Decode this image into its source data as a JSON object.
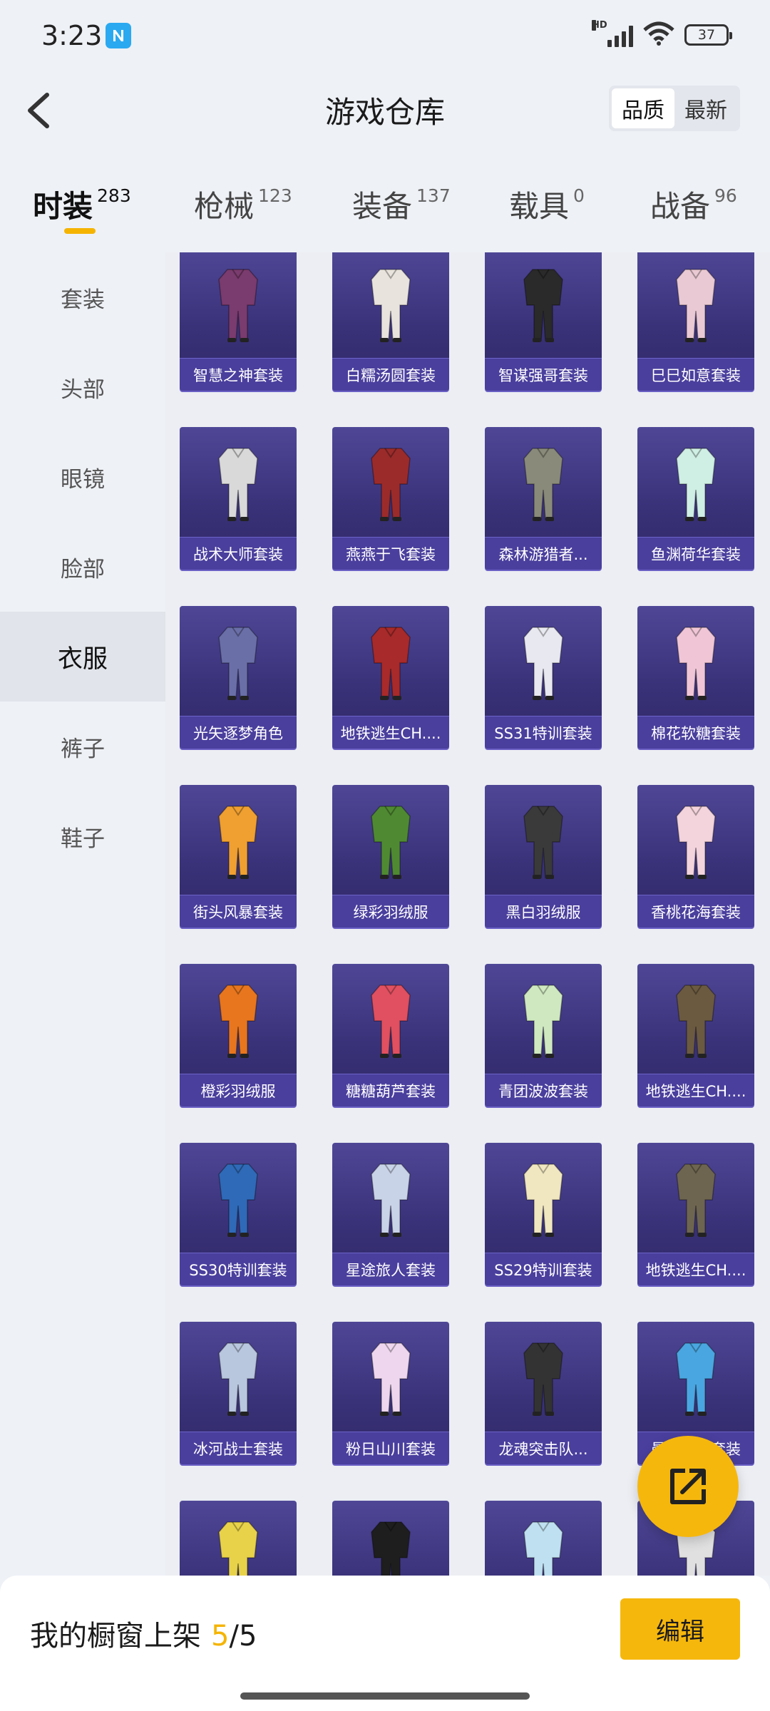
{
  "status_bar": {
    "time": "3:23",
    "battery": "37",
    "network": "HD"
  },
  "header": {
    "title": "游戏仓库",
    "sort_options": [
      "品质",
      "最新"
    ],
    "active_sort": "品质"
  },
  "tabs": [
    {
      "label": "时装",
      "count": "283",
      "active": true
    },
    {
      "label": "枪械",
      "count": "123",
      "active": false
    },
    {
      "label": "装备",
      "count": "137",
      "active": false
    },
    {
      "label": "载具",
      "count": "0",
      "active": false
    },
    {
      "label": "战备",
      "count": "96",
      "active": false
    }
  ],
  "sidebar": {
    "items": [
      "套装",
      "头部",
      "眼镜",
      "脸部",
      "衣服",
      "裤子",
      "鞋子"
    ],
    "active": "衣服"
  },
  "items": [
    {
      "name": "智慧之神套装",
      "color": "#7a3b6e"
    },
    {
      "name": "白糯汤圆套装",
      "color": "#e8e3dd"
    },
    {
      "name": "智谋强哥套装",
      "color": "#2a2a2a"
    },
    {
      "name": "巳巳如意套装",
      "color": "#e9c9d3"
    },
    {
      "name": "战术大师套装",
      "color": "#d9d9d9"
    },
    {
      "name": "燕燕于飞套装",
      "color": "#9b2b2b"
    },
    {
      "name": "森林游猎者...",
      "color": "#8a8a7a"
    },
    {
      "name": "鱼渊荷华套装",
      "color": "#cfeee4"
    },
    {
      "name": "光矢逐梦角色",
      "color": "#6a6fa8"
    },
    {
      "name": "地铁逃生CH....",
      "color": "#a82a2a"
    },
    {
      "name": "SS31特训套装",
      "color": "#e8e8f0"
    },
    {
      "name": "棉花软糖套装",
      "color": "#f0c6d6"
    },
    {
      "name": "街头风暴套装",
      "color": "#f0a030"
    },
    {
      "name": "绿彩羽绒服",
      "color": "#4f8a32"
    },
    {
      "name": "黑白羽绒服",
      "color": "#3a3a3a"
    },
    {
      "name": "香桃花海套装",
      "color": "#f3d3dc"
    },
    {
      "name": "橙彩羽绒服",
      "color": "#e8761e"
    },
    {
      "name": "糖糖葫芦套装",
      "color": "#e05060"
    },
    {
      "name": "青团波波套装",
      "color": "#cfe8c0"
    },
    {
      "name": "地铁逃生CH....",
      "color": "#6b5a40"
    },
    {
      "name": "SS30特训套装",
      "color": "#2f6ab8"
    },
    {
      "name": "星途旅人套装",
      "color": "#c9d3e8"
    },
    {
      "name": "SS29特训套装",
      "color": "#f0e6c0"
    },
    {
      "name": "地铁逃生CH....",
      "color": "#6e6550"
    },
    {
      "name": "冰河战士套装",
      "color": "#b8c6de"
    },
    {
      "name": "粉日山川套装",
      "color": "#eed7ee"
    },
    {
      "name": "龙魂突击队...",
      "color": "#333333"
    },
    {
      "name": "曼妙人鱼套装",
      "color": "#4aa6e0"
    },
    {
      "name": "",
      "color": "#e8d24a"
    },
    {
      "name": "",
      "color": "#1e1e1e"
    },
    {
      "name": "",
      "color": "#bfe0f0"
    },
    {
      "name": "",
      "color": "#e0e0e0"
    }
  ],
  "bottom_bar": {
    "label": "我的橱窗上架",
    "count_current": "5",
    "count_sep": "/",
    "count_total": "5",
    "edit_label": "编辑"
  },
  "colors": {
    "accent": "#f5b400",
    "card_bg": "#3a3279"
  },
  "icons": {
    "back": "chevron-left-icon",
    "share": "share-external-icon",
    "nfc": "nfc-icon"
  }
}
